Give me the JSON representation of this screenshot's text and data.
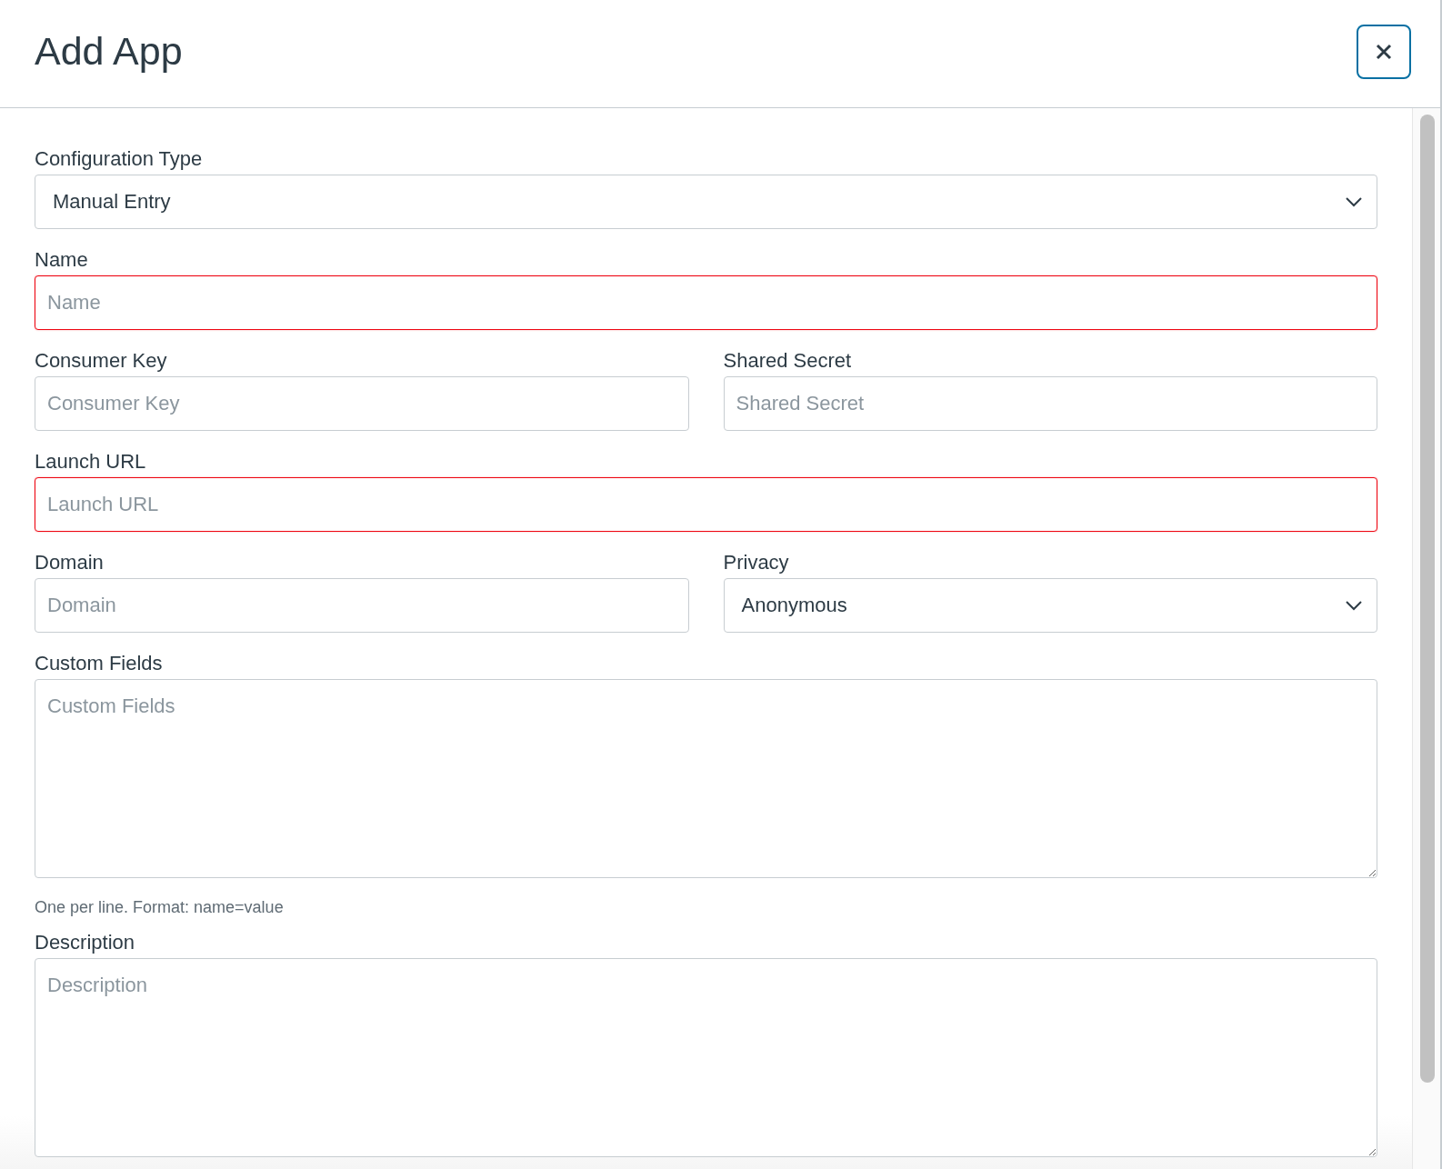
{
  "dialog": {
    "title": "Add App"
  },
  "rows": [
    [
      {
        "kind": "select",
        "label": "Configuration Type",
        "value": "Manual Entry",
        "invalid": false
      }
    ],
    [
      {
        "kind": "text",
        "label": "Name",
        "placeholder": "Name",
        "invalid": true
      }
    ],
    [
      {
        "kind": "text",
        "label": "Consumer Key",
        "placeholder": "Consumer Key",
        "invalid": false
      },
      {
        "kind": "text",
        "label": "Shared Secret",
        "placeholder": "Shared Secret",
        "invalid": false
      }
    ],
    [
      {
        "kind": "text",
        "label": "Launch URL",
        "placeholder": "Launch URL",
        "invalid": true
      }
    ],
    [
      {
        "kind": "text",
        "label": "Domain",
        "placeholder": "Domain",
        "invalid": false
      },
      {
        "kind": "select",
        "label": "Privacy",
        "value": "Anonymous",
        "invalid": false
      }
    ],
    [
      {
        "kind": "textarea",
        "label": "Custom Fields",
        "placeholder": "Custom Fields",
        "invalid": false,
        "hint": "One per line. Format: name=value"
      }
    ],
    [
      {
        "kind": "textarea",
        "label": "Description",
        "placeholder": "Description",
        "invalid": false
      }
    ]
  ]
}
